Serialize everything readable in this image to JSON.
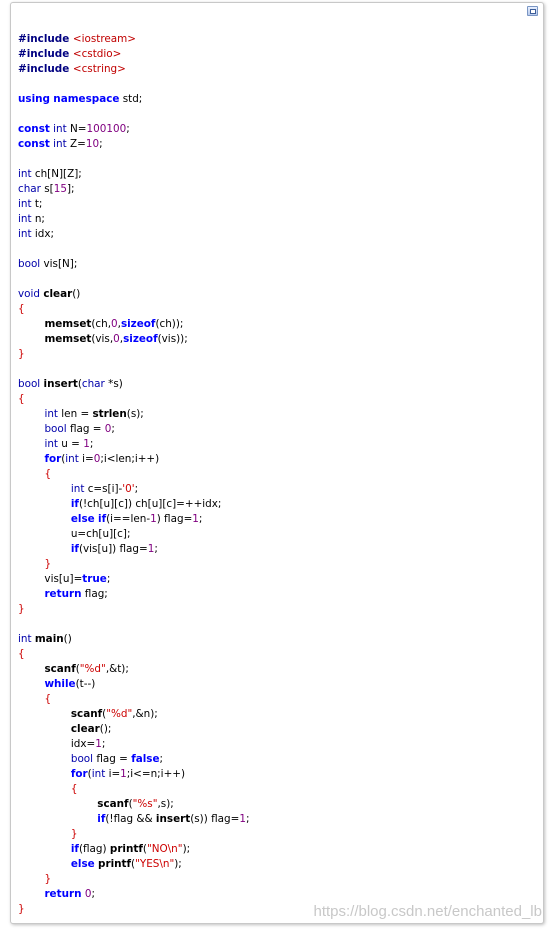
{
  "code": {
    "language": "cpp",
    "lines": [
      [
        {
          "t": "#include ",
          "c": "pp"
        },
        {
          "t": "<iostream>",
          "c": "inc"
        }
      ],
      [
        {
          "t": "#include ",
          "c": "pp"
        },
        {
          "t": "<cstdio>",
          "c": "inc"
        }
      ],
      [
        {
          "t": "#include ",
          "c": "pp"
        },
        {
          "t": "<cstring>",
          "c": "inc"
        }
      ],
      [],
      [
        {
          "t": "using",
          "c": "kw"
        },
        {
          "t": " "
        },
        {
          "t": "namespace",
          "c": "kw"
        },
        {
          "t": " std;"
        }
      ],
      [],
      [
        {
          "t": "const",
          "c": "kw"
        },
        {
          "t": " "
        },
        {
          "t": "int",
          "c": "ty"
        },
        {
          "t": " N="
        },
        {
          "t": "100100",
          "c": "num"
        },
        {
          "t": ";"
        }
      ],
      [
        {
          "t": "const",
          "c": "kw"
        },
        {
          "t": " "
        },
        {
          "t": "int",
          "c": "ty"
        },
        {
          "t": " Z="
        },
        {
          "t": "10",
          "c": "num"
        },
        {
          "t": ";"
        }
      ],
      [],
      [
        {
          "t": "int",
          "c": "ty"
        },
        {
          "t": " ch[N][Z];"
        }
      ],
      [
        {
          "t": "char",
          "c": "ty"
        },
        {
          "t": " s["
        },
        {
          "t": "15",
          "c": "num"
        },
        {
          "t": "];"
        }
      ],
      [
        {
          "t": "int",
          "c": "ty"
        },
        {
          "t": " t;"
        }
      ],
      [
        {
          "t": "int",
          "c": "ty"
        },
        {
          "t": " n;"
        }
      ],
      [
        {
          "t": "int",
          "c": "ty"
        },
        {
          "t": " idx;"
        }
      ],
      [],
      [
        {
          "t": "bool",
          "c": "ty"
        },
        {
          "t": " vis[N];"
        }
      ],
      [],
      [
        {
          "t": "void",
          "c": "ty"
        },
        {
          "t": " "
        },
        {
          "t": "clear",
          "c": "fn"
        },
        {
          "t": "()"
        }
      ],
      [
        {
          "t": "{",
          "c": "pun"
        }
      ],
      [
        {
          "t": "        "
        },
        {
          "t": "memset",
          "c": "fn"
        },
        {
          "t": "(ch,"
        },
        {
          "t": "0",
          "c": "num"
        },
        {
          "t": ","
        },
        {
          "t": "sizeof",
          "c": "kw"
        },
        {
          "t": "(ch));"
        }
      ],
      [
        {
          "t": "        "
        },
        {
          "t": "memset",
          "c": "fn"
        },
        {
          "t": "(vis,"
        },
        {
          "t": "0",
          "c": "num"
        },
        {
          "t": ","
        },
        {
          "t": "sizeof",
          "c": "kw"
        },
        {
          "t": "(vis));"
        }
      ],
      [
        {
          "t": "}",
          "c": "pun"
        }
      ],
      [],
      [
        {
          "t": "bool",
          "c": "ty"
        },
        {
          "t": " "
        },
        {
          "t": "insert",
          "c": "fn"
        },
        {
          "t": "("
        },
        {
          "t": "char",
          "c": "ty"
        },
        {
          "t": " *s)"
        }
      ],
      [
        {
          "t": "{",
          "c": "pun"
        }
      ],
      [
        {
          "t": "        "
        },
        {
          "t": "int",
          "c": "ty"
        },
        {
          "t": " len = "
        },
        {
          "t": "strlen",
          "c": "fn"
        },
        {
          "t": "(s);"
        }
      ],
      [
        {
          "t": "        "
        },
        {
          "t": "bool",
          "c": "ty"
        },
        {
          "t": " flag = "
        },
        {
          "t": "0",
          "c": "num"
        },
        {
          "t": ";"
        }
      ],
      [
        {
          "t": "        "
        },
        {
          "t": "int",
          "c": "ty"
        },
        {
          "t": " u = "
        },
        {
          "t": "1",
          "c": "num"
        },
        {
          "t": ";"
        }
      ],
      [
        {
          "t": "        "
        },
        {
          "t": "for",
          "c": "kw"
        },
        {
          "t": "("
        },
        {
          "t": "int",
          "c": "ty"
        },
        {
          "t": " i="
        },
        {
          "t": "0",
          "c": "num"
        },
        {
          "t": ";i<len;i++)"
        }
      ],
      [
        {
          "t": "        "
        },
        {
          "t": "{",
          "c": "pun"
        }
      ],
      [
        {
          "t": "                "
        },
        {
          "t": "int",
          "c": "ty"
        },
        {
          "t": " c=s[i]-"
        },
        {
          "t": "'0'",
          "c": "str"
        },
        {
          "t": ";"
        }
      ],
      [
        {
          "t": "                "
        },
        {
          "t": "if",
          "c": "kw"
        },
        {
          "t": "(!ch[u][c]) ch[u][c]=++idx;"
        }
      ],
      [
        {
          "t": "                "
        },
        {
          "t": "else",
          "c": "kw"
        },
        {
          "t": " "
        },
        {
          "t": "if",
          "c": "kw"
        },
        {
          "t": "(i==len-"
        },
        {
          "t": "1",
          "c": "num"
        },
        {
          "t": ") flag="
        },
        {
          "t": "1",
          "c": "num"
        },
        {
          "t": ";"
        }
      ],
      [
        {
          "t": "                u=ch[u][c];"
        }
      ],
      [
        {
          "t": "                "
        },
        {
          "t": "if",
          "c": "kw"
        },
        {
          "t": "(vis[u]) flag="
        },
        {
          "t": "1",
          "c": "num"
        },
        {
          "t": ";"
        }
      ],
      [
        {
          "t": "        "
        },
        {
          "t": "}",
          "c": "pun"
        }
      ],
      [
        {
          "t": "        vis[u]="
        },
        {
          "t": "true",
          "c": "kw"
        },
        {
          "t": ";"
        }
      ],
      [
        {
          "t": "        "
        },
        {
          "t": "return",
          "c": "kw"
        },
        {
          "t": " flag;"
        }
      ],
      [
        {
          "t": "}",
          "c": "pun"
        }
      ],
      [],
      [
        {
          "t": "int",
          "c": "ty"
        },
        {
          "t": " "
        },
        {
          "t": "main",
          "c": "fn"
        },
        {
          "t": "()"
        }
      ],
      [
        {
          "t": "{",
          "c": "pun"
        }
      ],
      [
        {
          "t": "        "
        },
        {
          "t": "scanf",
          "c": "fn"
        },
        {
          "t": "("
        },
        {
          "t": "\"%d\"",
          "c": "str"
        },
        {
          "t": ",&t);"
        }
      ],
      [
        {
          "t": "        "
        },
        {
          "t": "while",
          "c": "kw"
        },
        {
          "t": "(t--)"
        }
      ],
      [
        {
          "t": "        "
        },
        {
          "t": "{",
          "c": "pun"
        }
      ],
      [
        {
          "t": "                "
        },
        {
          "t": "scanf",
          "c": "fn"
        },
        {
          "t": "("
        },
        {
          "t": "\"%d\"",
          "c": "str"
        },
        {
          "t": ",&n);"
        }
      ],
      [
        {
          "t": "                "
        },
        {
          "t": "clear",
          "c": "fn"
        },
        {
          "t": "();"
        }
      ],
      [
        {
          "t": "                idx="
        },
        {
          "t": "1",
          "c": "num"
        },
        {
          "t": ";"
        }
      ],
      [
        {
          "t": "                "
        },
        {
          "t": "bool",
          "c": "ty"
        },
        {
          "t": " flag = "
        },
        {
          "t": "false",
          "c": "kw"
        },
        {
          "t": ";"
        }
      ],
      [
        {
          "t": "                "
        },
        {
          "t": "for",
          "c": "kw"
        },
        {
          "t": "("
        },
        {
          "t": "int",
          "c": "ty"
        },
        {
          "t": " i="
        },
        {
          "t": "1",
          "c": "num"
        },
        {
          "t": ";i<=n;i++)"
        }
      ],
      [
        {
          "t": "                "
        },
        {
          "t": "{",
          "c": "pun"
        }
      ],
      [
        {
          "t": "                        "
        },
        {
          "t": "scanf",
          "c": "fn"
        },
        {
          "t": "("
        },
        {
          "t": "\"%s\"",
          "c": "str"
        },
        {
          "t": ",s);"
        }
      ],
      [
        {
          "t": "                        "
        },
        {
          "t": "if",
          "c": "kw"
        },
        {
          "t": "(!flag && "
        },
        {
          "t": "insert",
          "c": "fn"
        },
        {
          "t": "(s)) flag="
        },
        {
          "t": "1",
          "c": "num"
        },
        {
          "t": ";"
        }
      ],
      [
        {
          "t": "                "
        },
        {
          "t": "}",
          "c": "pun"
        }
      ],
      [
        {
          "t": "                "
        },
        {
          "t": "if",
          "c": "kw"
        },
        {
          "t": "(flag) "
        },
        {
          "t": "printf",
          "c": "fn"
        },
        {
          "t": "("
        },
        {
          "t": "\"NO\\n\"",
          "c": "str"
        },
        {
          "t": ");"
        }
      ],
      [
        {
          "t": "                "
        },
        {
          "t": "else",
          "c": "kw"
        },
        {
          "t": " "
        },
        {
          "t": "printf",
          "c": "fn"
        },
        {
          "t": "("
        },
        {
          "t": "\"YES\\n\"",
          "c": "str"
        },
        {
          "t": ");"
        }
      ],
      [
        {
          "t": "        "
        },
        {
          "t": "}",
          "c": "pun"
        }
      ],
      [
        {
          "t": "        "
        },
        {
          "t": "return",
          "c": "kw"
        },
        {
          "t": " "
        },
        {
          "t": "0",
          "c": "num"
        },
        {
          "t": ";"
        }
      ],
      [
        {
          "t": "}",
          "c": "pun"
        }
      ]
    ]
  },
  "watermark": "https://blog.csdn.net/enchanted_lb",
  "icons": {
    "toolbar": "view-source-icon"
  }
}
